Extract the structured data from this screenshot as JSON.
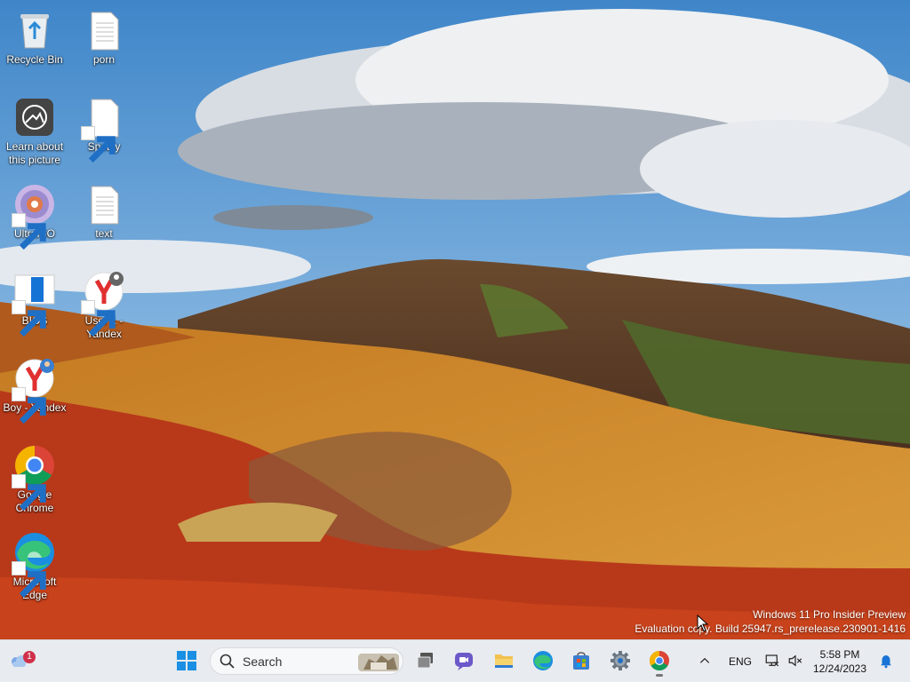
{
  "desktop": {
    "icons": [
      {
        "label": "Recycle Bin",
        "icon": "recycle-bin-icon"
      },
      {
        "label": "porn",
        "icon": "text-file-icon"
      },
      {
        "label": "Learn about this picture",
        "icon": "learn-picture-icon"
      },
      {
        "label": "Spotify",
        "icon": "file-shortcut-icon"
      },
      {
        "label": "UltraISO",
        "icon": "disc-icon"
      },
      {
        "label": "text",
        "icon": "text-file-icon"
      },
      {
        "label": "BIOS",
        "icon": "bios-icon"
      },
      {
        "label": "User 1 - Yandex",
        "icon": "yandex-icon"
      },
      {
        "label": "Boy - Yandex",
        "icon": "yandex-icon"
      },
      {
        "label": "Google Chrome",
        "icon": "chrome-icon"
      },
      {
        "label": "Microsoft Edge",
        "icon": "edge-icon"
      }
    ]
  },
  "watermark": {
    "line1": "Windows 11 Pro Insider Preview",
    "line2": "Evaluation copy. Build 25947.rs_prerelease.230901-1416"
  },
  "taskbar": {
    "weather_badge": "1",
    "search_placeholder": "Search",
    "apps": [
      "start-icon",
      "task-view-icon",
      "teams-chat-icon",
      "file-explorer-icon",
      "edge-icon",
      "store-icon",
      "settings-icon",
      "chrome-icon"
    ],
    "tray": {
      "language": "ENG",
      "time": "5:58 PM",
      "date": "12/24/2023"
    }
  },
  "colors": {
    "taskbar_bg": "#e8ebef",
    "accent": "#0078d4"
  }
}
